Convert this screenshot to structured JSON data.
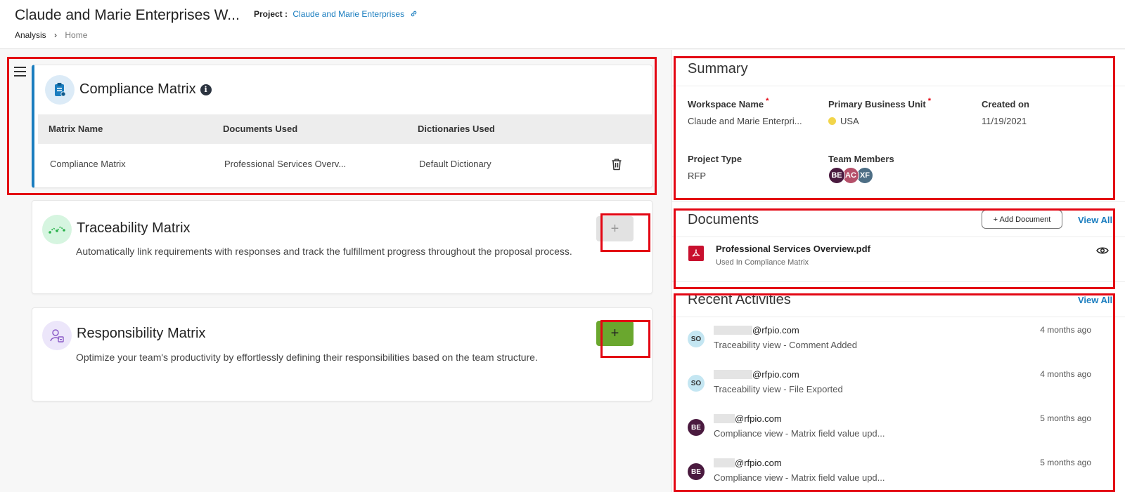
{
  "header": {
    "workspace_title": "Claude and Marie Enterprises W...",
    "project_label": "Project :",
    "project_name": "Claude and Marie Enterprises",
    "breadcrumb": [
      "Analysis",
      "Home"
    ]
  },
  "compliance": {
    "title": "Compliance Matrix",
    "columns": [
      "Matrix Name",
      "Documents Used",
      "Dictionaries Used"
    ],
    "rows": [
      {
        "matrix_name": "Compliance Matrix",
        "documents_used": "Professional Services Overv...",
        "dictionaries_used": "Default Dictionary"
      }
    ]
  },
  "traceability": {
    "title": "Traceability Matrix",
    "description": "Automatically link requirements with responses and track the fulfillment progress throughout the proposal process.",
    "add_label": "+"
  },
  "responsibility": {
    "title": "Responsibility Matrix",
    "description": "Optimize your team's productivity by effortlessly defining their responsibilities based on the team structure.",
    "add_label": "+"
  },
  "summary": {
    "title": "Summary",
    "workspace_name_label": "Workspace Name",
    "workspace_name_value": "Claude and Marie Enterpri...",
    "business_unit_label": "Primary Business Unit",
    "business_unit_value": "USA",
    "created_on_label": "Created on",
    "created_on_value": "11/19/2021",
    "project_type_label": "Project Type",
    "project_type_value": "RFP",
    "team_members_label": "Team Members",
    "team_members": [
      {
        "initials": "BE",
        "color": "#4a1a3f"
      },
      {
        "initials": "AC",
        "color": "#b5506a"
      },
      {
        "initials": "XF",
        "color": "#4d6e85"
      }
    ],
    "required_mark": "*"
  },
  "documents": {
    "title": "Documents",
    "add_label": "+ Add Document",
    "view_all_label": "View All",
    "items": [
      {
        "name": "Professional Services Overview.pdf",
        "usage": "Used In Compliance Matrix"
      }
    ]
  },
  "activities": {
    "title": "Recent Activities",
    "view_all_label": "View All",
    "items": [
      {
        "initials": "SO",
        "email": "@rfpio.com",
        "description": "Traceability view - Comment Added",
        "time": "4 months ago"
      },
      {
        "initials": "SO",
        "email": "@rfpio.com",
        "description": "Traceability view - File Exported",
        "time": "4 months ago"
      },
      {
        "initials": "BE",
        "email": "@rfpio.com",
        "description": "Compliance view - Matrix field value upd...",
        "time": "5 months ago"
      },
      {
        "initials": "BE",
        "email": "@rfpio.com",
        "description": "Compliance view - Matrix field value upd...",
        "time": "5 months ago"
      }
    ]
  },
  "colors": {
    "accent": "#1a7dbf",
    "highlight_box": "#e30613",
    "add_active": "#6aa72e",
    "pdf": "#c8102e"
  }
}
